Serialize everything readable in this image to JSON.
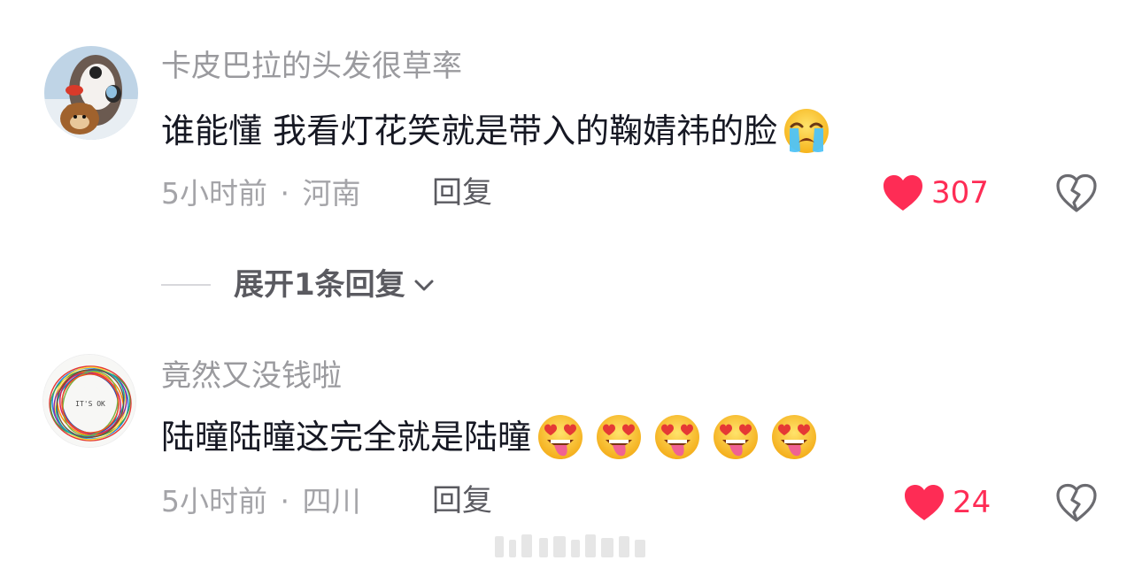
{
  "comments": [
    {
      "username": "卡皮巴拉的头发很草率",
      "text": "谁能懂 我看灯花笑就是带入的鞠婧祎的脸",
      "emojis": [
        "loudly-crying-face-emoji"
      ],
      "time": "5小时前",
      "separator": "·",
      "location": "河南",
      "reply_label": "回复",
      "like_count": "307"
    },
    {
      "username": "竟然又没钱啦",
      "text": "陆曈陆曈这完全就是陆曈",
      "emojis": [
        "heart-eyes-tongue-emoji",
        "heart-eyes-tongue-emoji",
        "heart-eyes-tongue-emoji",
        "heart-eyes-tongue-emoji",
        "heart-eyes-tongue-emoji"
      ],
      "avatar_text": "IT'S OK",
      "time": "5小时前",
      "separator": "·",
      "location": "四川",
      "reply_label": "回复",
      "like_count": "24"
    }
  ],
  "expand_replies": {
    "label": "展开1条回复"
  },
  "icons": {
    "like": "heart-icon",
    "dislike": "broken-heart-icon",
    "expand": "chevron-down-icon"
  },
  "colors": {
    "like_red": "#fe2c55",
    "username_gray": "#9a9a9e",
    "text_dark": "#161823",
    "dislike_gray": "#6b6b70"
  }
}
